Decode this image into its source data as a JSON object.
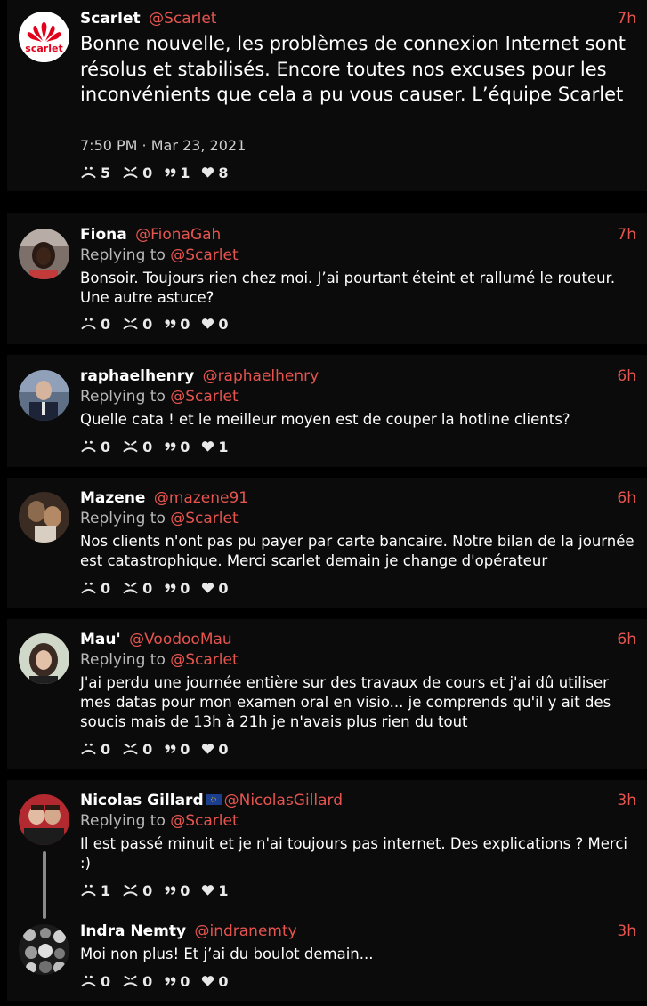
{
  "main_tweet": {
    "name": "Scarlet",
    "handle": "@Scarlet",
    "time": "7h",
    "logo_text": "scarlet",
    "text": "Bonne nouvelle, les problèmes de connexion Internet sont résolus et stabilisés. Encore toutes nos excuses pour les inconvénients que cela a pu vous causer. L’équipe Scarlet",
    "timestamp": "7:50 PM · Mar 23, 2021",
    "counts": {
      "sad": "5",
      "angry": "0",
      "quote": "1",
      "like": "8"
    }
  },
  "replying_label": "Replying to",
  "replies": [
    {
      "name": "Fiona",
      "handle": "@FionaGah",
      "time": "7h",
      "replying_to": "@Scarlet",
      "text": "Bonsoir. Toujours rien chez moi. J’ai pourtant éteint et rallumé le routeur. Une autre astuce?",
      "counts": {
        "sad": "0",
        "angry": "0",
        "quote": "0",
        "like": "0"
      }
    },
    {
      "name": "raphaelhenry",
      "handle": "@raphaelhenry",
      "time": "6h",
      "replying_to": "@Scarlet",
      "text": "Quelle cata ! et le meilleur moyen est de couper la hotline clients?",
      "counts": {
        "sad": "0",
        "angry": "0",
        "quote": "0",
        "like": "1"
      }
    },
    {
      "name": "Mazene",
      "handle": "@mazene91",
      "time": "6h",
      "replying_to": "@Scarlet",
      "text": "Nos clients n'ont pas pu payer par carte bancaire.  Notre bilan de la journée est catastrophique.  Merci scarlet demain je change d'opérateur",
      "counts": {
        "sad": "0",
        "angry": "0",
        "quote": "0",
        "like": "0"
      }
    },
    {
      "name": "Mau'",
      "handle": "@VoodooMau",
      "time": "6h",
      "replying_to": "@Scarlet",
      "text": "J'ai perdu une journée entière sur des travaux de cours et j'ai dû utiliser mes datas pour mon examen oral en visio... je comprends qu'il y ait des soucis mais de 13h à 21h je n'avais plus rien du tout",
      "counts": {
        "sad": "0",
        "angry": "0",
        "quote": "0",
        "like": "0"
      }
    },
    {
      "name": "Nicolas Gillard",
      "handle": "@NicolasGillard",
      "time": "3h",
      "replying_to": "@Scarlet",
      "flag": "eu-flag-icon",
      "text": "Il est passé minuit et je n'ai toujours pas internet. Des explications ? Merci :)",
      "counts": {
        "sad": "1",
        "angry": "0",
        "quote": "0",
        "like": "1"
      }
    },
    {
      "name": "Indra Nemty",
      "handle": "@indranemty",
      "time": "3h",
      "text": "Moi non plus! Et j’ai du boulot demain...",
      "counts": {
        "sad": "0",
        "angry": "0",
        "quote": "0",
        "like": "0"
      }
    }
  ],
  "colors": {
    "accent": "#e5544f",
    "card": "#0b0b0b",
    "background": "#000000"
  }
}
